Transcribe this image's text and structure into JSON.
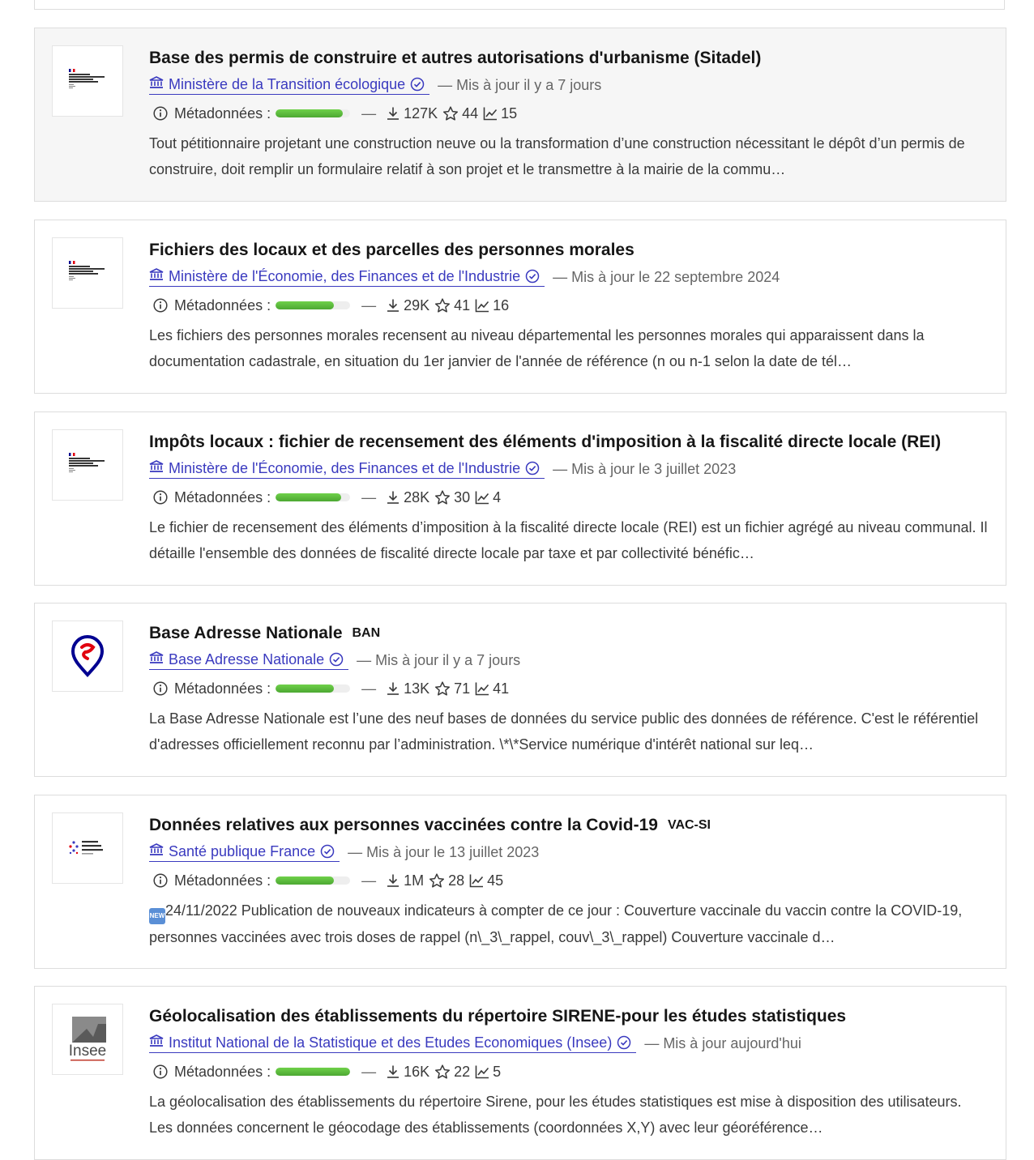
{
  "colors": {
    "link": "#3a3abf",
    "muted": "#666666",
    "quality_fill": "#5cc03a",
    "card_border": "#dddddd",
    "hover_bg": "#f6f6f6"
  },
  "datasets": [
    {
      "title": "Base des permis de construire et autres autorisations d'urbanisme (Sitadel)",
      "acronym": "",
      "organization": "Ministère de la Transition écologique",
      "updated": "— Mis à jour il y a 7 jours",
      "metadata_label": "Métadonnées :",
      "quality": 0.9,
      "downloads": "127K",
      "stars": "44",
      "reuses": "15",
      "description": "Tout pétitionnaire projetant une construction neuve ou la transformation d’une construction nécessitant le dépôt d’un permis de construire, doit remplir un formulaire relatif à son projet et le transmettre à la mairie de la commu…",
      "logo": "marianne",
      "logo_text": "MINISTÈRE DE LA TRANSITION ÉCOLOGIQUE",
      "hovered": true
    },
    {
      "title": "Fichiers des locaux et des parcelles des personnes morales",
      "acronym": "",
      "organization": "Ministère de l'Économie, des Finances et de l'Industrie",
      "updated": "— Mis à jour le 22 septembre 2024",
      "metadata_label": "Métadonnées :",
      "quality": 0.78,
      "downloads": "29K",
      "stars": "41",
      "reuses": "16",
      "description": "Les fichiers des personnes morales recensent au niveau départemental les personnes morales qui apparaissent dans la documentation cadastrale, en situation du 1er janvier de l'année de référence (n ou n-1 selon la date de tél…",
      "logo": "marianne",
      "logo_text": "MINISTÈRE DE L'ÉCONOMIE DES FINANCES ET DE L'INDUSTRIE",
      "hovered": false
    },
    {
      "title": "Impôts locaux : fichier de recensement des éléments d'imposition à la fiscalité directe locale (REI)",
      "acronym": "",
      "organization": "Ministère de l'Économie, des Finances et de l'Industrie",
      "updated": "— Mis à jour le 3 juillet 2023",
      "metadata_label": "Métadonnées :",
      "quality": 0.88,
      "downloads": "28K",
      "stars": "30",
      "reuses": "4",
      "description": "Le fichier de recensement des éléments d’imposition à la fiscalité directe locale (REI) est un fichier agrégé au niveau communal. Il détaille l'ensemble des données de fiscalité directe locale par taxe et par collectivité bénéfic…",
      "logo": "marianne",
      "logo_text": "MINISTÈRE DE L'ÉCONOMIE DES FINANCES ET DE L'INDUSTRIE",
      "hovered": false
    },
    {
      "title": "Base Adresse Nationale",
      "acronym": "BAN",
      "organization": "Base Adresse Nationale",
      "updated": "— Mis à jour il y a 7 jours",
      "metadata_label": "Métadonnées :",
      "quality": 0.78,
      "downloads": "13K",
      "stars": "71",
      "reuses": "41",
      "description": "La Base Adresse Nationale est l’une des neuf bases de données du service public des données de référence. C'est le référentiel d'adresses officiellement reconnu par l’administration. \\*\\*Service numérique d'intérêt national sur leq…",
      "logo": "ban",
      "logo_text": "",
      "hovered": false
    },
    {
      "title": "Données relatives aux personnes vaccinées contre la Covid-19",
      "acronym": "VAC-SI",
      "organization": "Santé publique France",
      "updated": "— Mis à jour le 13 juillet 2023",
      "metadata_label": "Métadonnées :",
      "quality": 0.78,
      "downloads": "1M",
      "stars": "28",
      "reuses": "45",
      "description_badge": "NEW",
      "description": "24/11/2022 Publication de nouveaux indicateurs à compter de ce jour : Couverture vaccinale du vaccin contre la COVID-19, personnes vaccinées avec trois doses de rappel (n\\_3\\_rappel, couv\\_3\\_rappel) Couverture vaccinale d…",
      "logo": "spf",
      "logo_text": "Santé publique France",
      "hovered": false
    },
    {
      "title": "Géolocalisation des établissements du répertoire SIRENE-pour les études statistiques",
      "acronym": "",
      "organization": "Institut National de la Statistique et des Etudes Economiques (Insee)",
      "updated": "— Mis à jour aujourd'hui",
      "metadata_label": "Métadonnées :",
      "quality": 1.0,
      "downloads": "16K",
      "stars": "22",
      "reuses": "5",
      "description": "La géolocalisation des établissements du répertoire Sirene, pour les études statistiques est mise à disposition des utilisateurs. Les données concernent le géocodage des établissements (coordonnées X,Y) avec leur géoréférence…",
      "logo": "insee",
      "logo_text": "Insee",
      "hovered": false
    }
  ]
}
